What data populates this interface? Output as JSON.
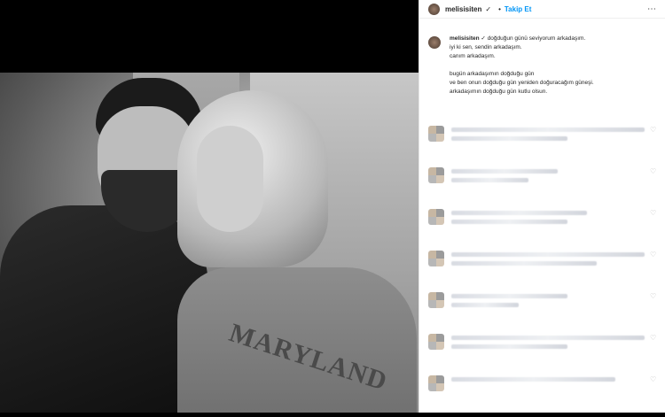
{
  "post": {
    "username": "melisisiten",
    "verified_icon": "verified-badge-icon",
    "follow_label": "Takip Et",
    "caption_lines": [
      "doğduğun günü seviyorum arkadaşım.",
      "iyi ki sen, sendin arkadaşım.",
      "canım arkadaşım.",
      "bugün arkadaşımın doğduğu gün",
      "ve ben onun doğduğu gün yeniden doğuracağım güneşi.",
      "arkadaşımın doğduğu gün kutlu olsun."
    ],
    "photo_print": "MARYLAND"
  },
  "comments": [
    {
      "avatar_icon": "blurred-avatar-icon"
    },
    {
      "avatar_icon": "blurred-avatar-icon"
    },
    {
      "avatar_icon": "blurred-avatar-icon"
    },
    {
      "avatar_icon": "blurred-avatar-icon"
    },
    {
      "avatar_icon": "blurred-avatar-icon"
    },
    {
      "avatar_icon": "blurred-avatar-icon"
    },
    {
      "avatar_icon": "blurred-avatar-icon"
    }
  ]
}
